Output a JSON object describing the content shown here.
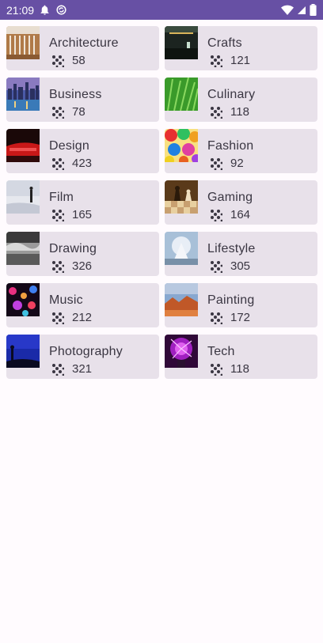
{
  "status": {
    "time": "21:09"
  },
  "topics": [
    {
      "title": "Architecture",
      "count": "58"
    },
    {
      "title": "Crafts",
      "count": "121"
    },
    {
      "title": "Business",
      "count": "78"
    },
    {
      "title": "Culinary",
      "count": "118"
    },
    {
      "title": "Design",
      "count": "423"
    },
    {
      "title": "Fashion",
      "count": "92"
    },
    {
      "title": "Film",
      "count": "165"
    },
    {
      "title": "Gaming",
      "count": "164"
    },
    {
      "title": "Drawing",
      "count": "326"
    },
    {
      "title": "Lifestyle",
      "count": "305"
    },
    {
      "title": "Music",
      "count": "212"
    },
    {
      "title": "Painting",
      "count": "172"
    },
    {
      "title": "Photography",
      "count": "321"
    },
    {
      "title": "Tech",
      "count": "118"
    }
  ]
}
